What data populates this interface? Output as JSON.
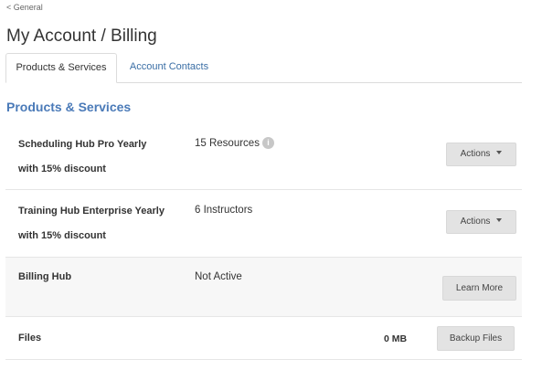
{
  "nav": {
    "back_label": "< General"
  },
  "header": {
    "title": "My Account / Billing"
  },
  "tabs": [
    {
      "label": "Products & Services",
      "active": true
    },
    {
      "label": "Account Contacts",
      "active": false
    }
  ],
  "section": {
    "title": "Products & Services"
  },
  "products": [
    {
      "name": "Scheduling Hub Pro Yearly with 15% discount",
      "detail": "15 Resources",
      "has_info_icon": true,
      "button": "Actions"
    },
    {
      "name": "Training Hub Enterprise Yearly with 15% discount",
      "detail": "6 Instructors",
      "button": "Actions"
    },
    {
      "name": "Billing Hub",
      "detail": "Not Active",
      "button": "Learn More"
    }
  ],
  "files": {
    "name": "Files",
    "size": "0 MB",
    "button": "Backup Files"
  },
  "icons": {
    "info": "info-icon",
    "dropdown": "caret-down-icon"
  },
  "colors": {
    "accent": "#4a7ab8",
    "tab_link": "#3a6ea5",
    "button_bg": "#e3e3e3"
  }
}
